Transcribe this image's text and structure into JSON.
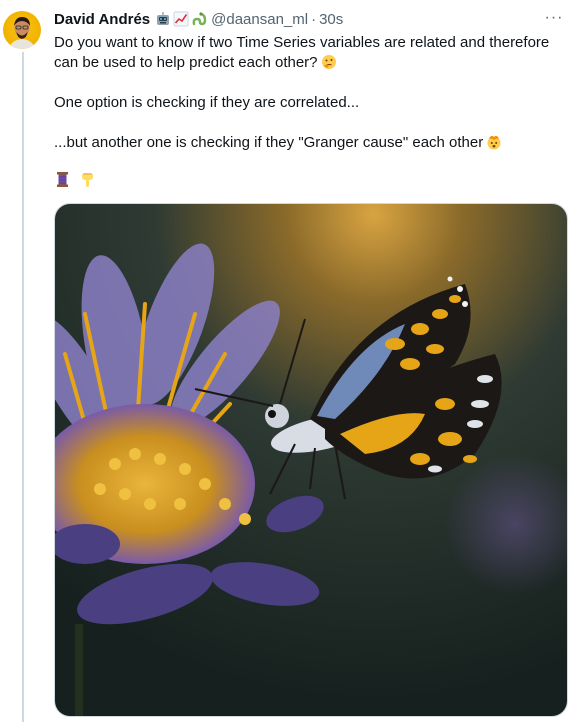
{
  "author": {
    "name": "David Andrés",
    "handle": "@daansan_ml",
    "separator": "·",
    "time": "30s",
    "badges": [
      "robot-emoji",
      "chart-increasing-emoji",
      "snake-emoji"
    ]
  },
  "menu": {
    "more_label": "···"
  },
  "tweet": {
    "line1": "Do you want to know if two Time Series variables are related and therefore can be used to help predict each other?",
    "line2": "One option is checking if they are correlated...",
    "line3": "...but another one is checking if they \"Granger cause\" each other",
    "trailing_emojis": [
      "thread-spool-emoji",
      "pointing-down-emoji"
    ]
  },
  "media": {
    "description_icon": "image-butterfly-on-flower",
    "colors": {
      "background": "#1f2d2a",
      "glow": "#d9a441",
      "petal": "#8a7fc4",
      "wing_orange": "#e6a417",
      "wing_black": "#1b1816",
      "wing_blue": "#6f8ab8"
    }
  }
}
